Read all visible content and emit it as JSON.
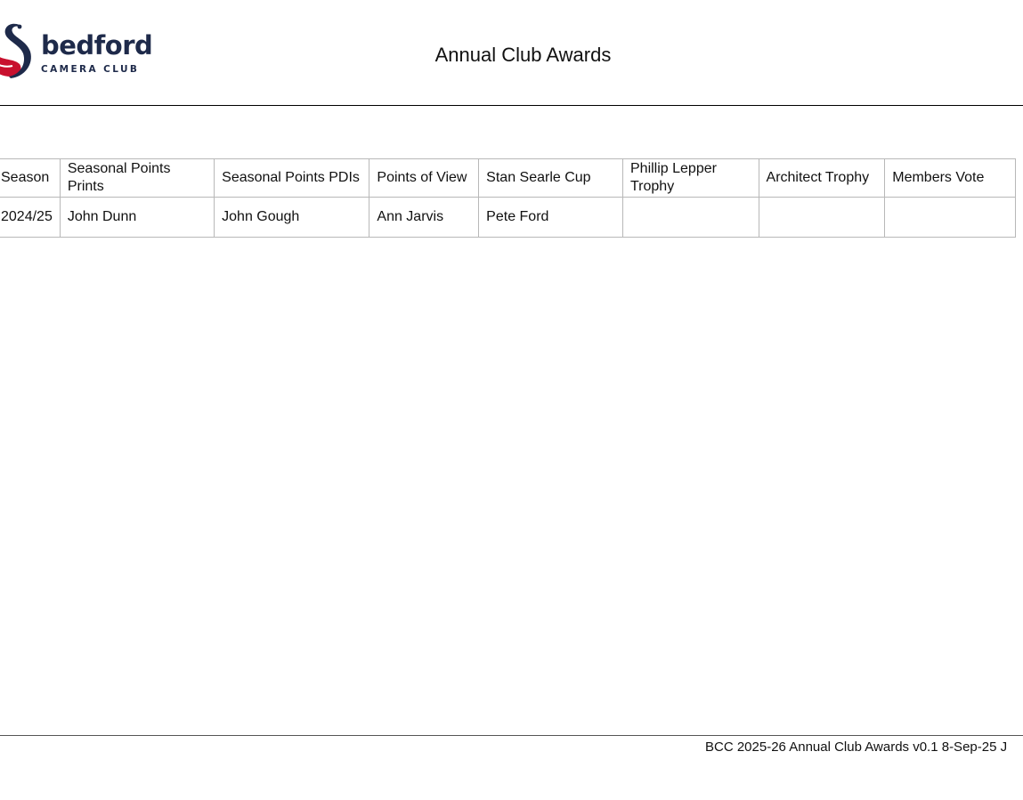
{
  "header": {
    "logo": {
      "word": "bedford",
      "sub": "CAMERA CLUB",
      "colors": {
        "navy": "#1e2a4a",
        "red": "#c8102e"
      }
    },
    "title": "Annual Club Awards"
  },
  "table": {
    "columns": [
      "Season",
      "Seasonal Points Prints",
      "Seasonal Points PDIs",
      "Points of View",
      "Stan Searle Cup",
      "Phillip Lepper Trophy",
      "Architect Trophy",
      "Members Vote"
    ],
    "rows": [
      [
        "2024/25",
        "John Dunn",
        "John Gough",
        "Ann Jarvis",
        "Pete Ford",
        "",
        "",
        ""
      ]
    ]
  },
  "footer": {
    "text": "BCC 2025-26 Annual Club Awards v0.1 8-Sep-25 J"
  }
}
